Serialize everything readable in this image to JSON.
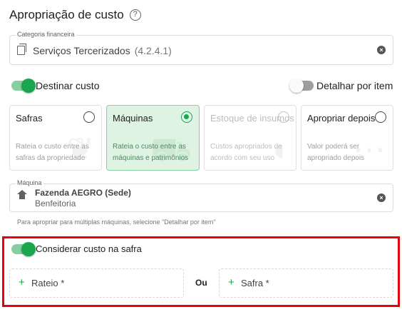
{
  "page": {
    "title": "Apropriação de custo",
    "help_icon": "help-circle-icon"
  },
  "categoria": {
    "label": "Categoria financeira",
    "value": "Serviços Tercerizados",
    "code": "(4.2.4.1)",
    "icon": "copy-icon",
    "clear_icon": "clear-icon"
  },
  "destinar_custo": {
    "label": "Destinar custo",
    "enabled": true
  },
  "detalhar_por_item": {
    "label": "Detalhar por item",
    "enabled": false
  },
  "options": [
    {
      "title": "Safras",
      "description": "Rateia o custo entre as safras da propriedade",
      "selected": false,
      "disabled": false,
      "watermark_icon": "wheat-icon"
    },
    {
      "title": "Máquinas",
      "description": "Rateia o custo entre as máquinas e patrimônios",
      "selected": true,
      "disabled": false,
      "watermark_icon": "tractor-icon"
    },
    {
      "title": "Estoque de insumos",
      "description": "Custos apropriados de acordo com seu uso",
      "selected": false,
      "disabled": true,
      "watermark_icon": "stock-icon"
    },
    {
      "title": "Apropriar depois",
      "description": "Valor poderá ser apropriado depois",
      "selected": false,
      "disabled": false,
      "watermark_icon": "ellipsis-icon"
    }
  ],
  "maquina": {
    "label": "Máquina",
    "name": "Fazenda AEGRO (Sede)",
    "subtitle": "Benfeitoria",
    "icon": "home-icon",
    "clear_icon": "clear-icon",
    "hint": "Para apropriar para múltiplas máquinas, selecione \"Detalhar por item\""
  },
  "considerar_safra": {
    "label": "Considerar custo na safra",
    "enabled": true
  },
  "rateio": {
    "label": "Rateio *",
    "icon": "plus-icon"
  },
  "ou_label": "Ou",
  "safra": {
    "label": "Safra *",
    "icon": "plus-icon"
  },
  "colors": {
    "accent": "#1aa64f",
    "selected_bg": "#dff3e4",
    "highlight": "#e8000b"
  }
}
